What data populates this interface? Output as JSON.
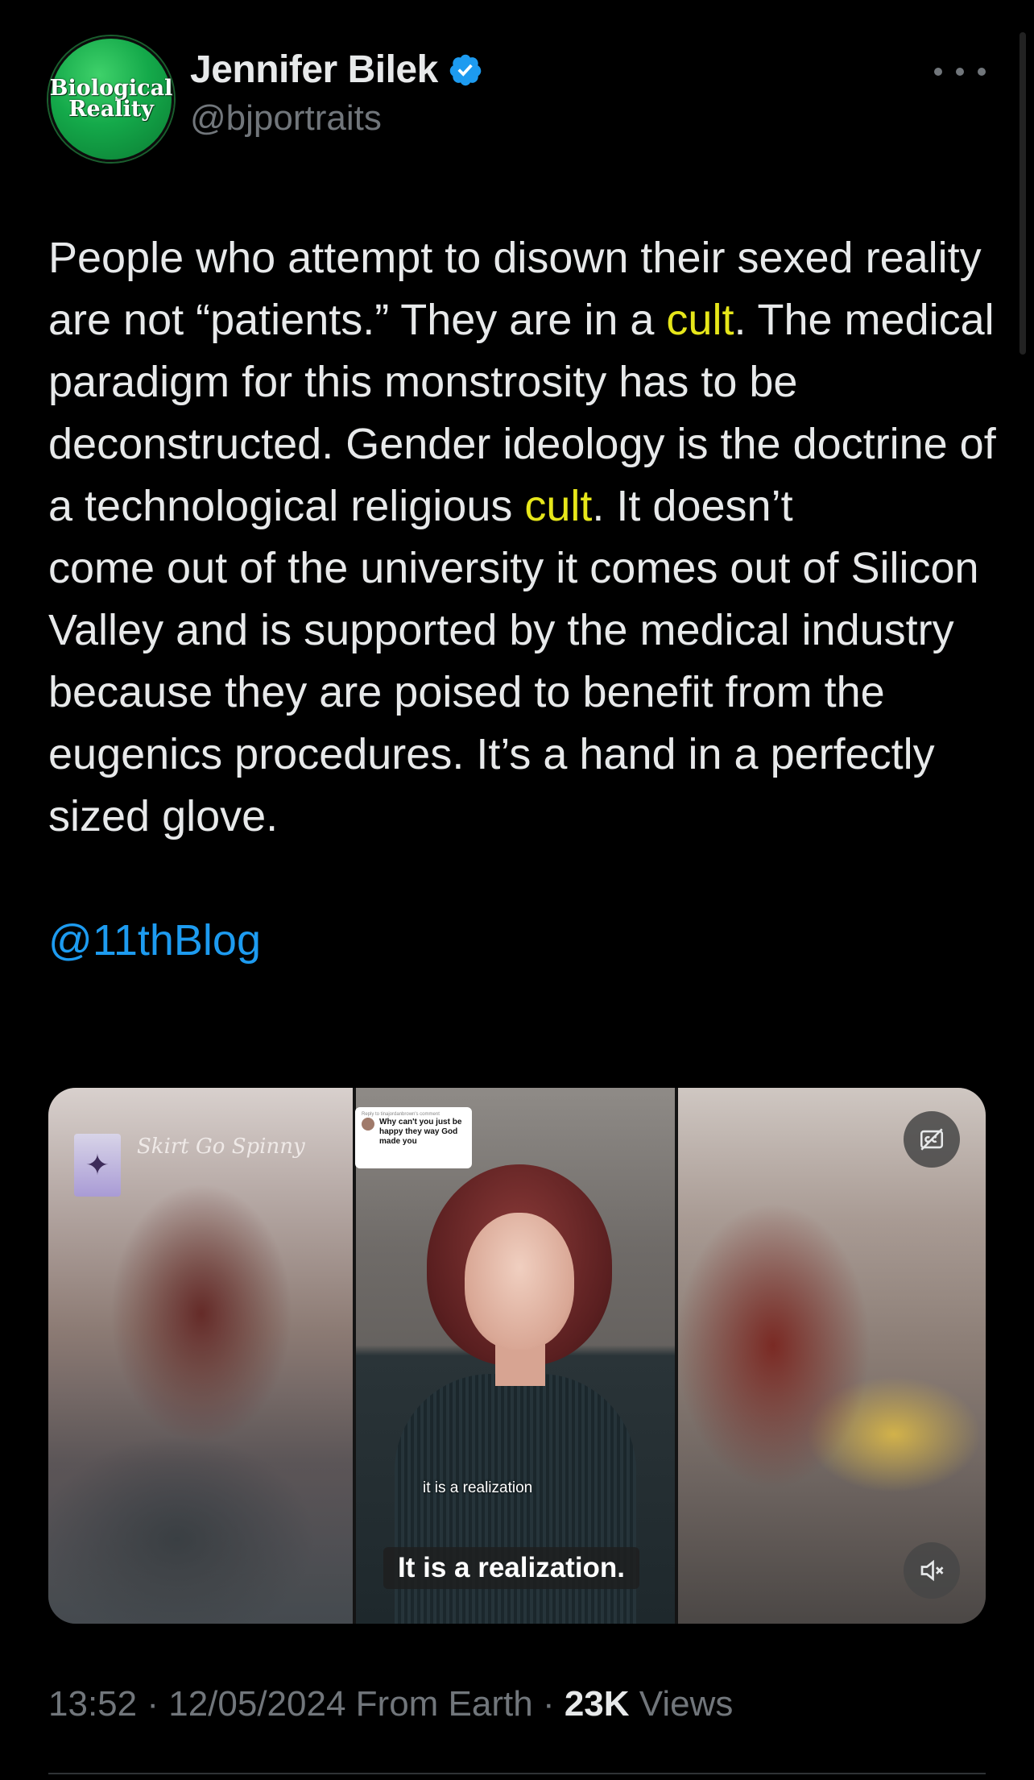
{
  "author": {
    "avatar_text_line1": "Biological",
    "avatar_text_line2": "Reality",
    "display_name": "Jennifer Bilek",
    "handle": "@bjportraits",
    "verified_badge_color": "#1d9bf0"
  },
  "tweet": {
    "text_part1": "People who attempt to disown their sexed reality are not “patients.” They are in a ",
    "highlight1": "cult",
    "text_part2": ". The medical paradigm for this monstrosity has to be deconstructed. Gender ideology is the doctrine of a technological religious ",
    "highlight2": "cult",
    "text_part3": ". It doesn’t\ncome out of the university it comes out of Silicon Valley and is supported by the medical industry because they are poised to benefit from the eugenics procedures. It’s a hand in a perfectly sized glove.\n\n",
    "mention": "@11thBlog",
    "highlight_color": "#e6e61a",
    "mention_color": "#1d9bf0"
  },
  "media": {
    "channel_name": "Skirt Go Spinny",
    "comment_reply_label": "Reply to tinajordanbrown's comment",
    "comment_text": "Why can't you just be happy they way God made you",
    "caption_small": "it is a realization",
    "caption_large": "It is a realization.",
    "cc_icon": "captions-off-icon",
    "mute_icon": "speaker-muted-icon"
  },
  "meta": {
    "time": "13:52",
    "separator1": " · ",
    "date": "12/05/2024",
    "source": " From Earth",
    "separator2": " · ",
    "views_count": "23K",
    "views_label": " Views"
  }
}
